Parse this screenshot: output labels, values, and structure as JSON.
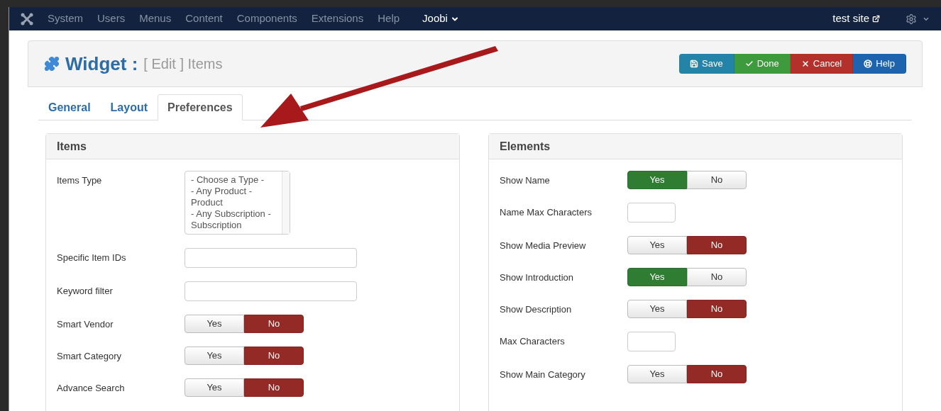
{
  "navbar": {
    "menu": [
      {
        "label": "System"
      },
      {
        "label": "Users"
      },
      {
        "label": "Menus"
      },
      {
        "label": "Content"
      },
      {
        "label": "Components"
      },
      {
        "label": "Extensions"
      },
      {
        "label": "Help"
      }
    ],
    "dropdown": "Joobi",
    "site_link": "test site"
  },
  "header": {
    "title": "Widget :",
    "subtitle": "[ Edit ] Items",
    "buttons": [
      {
        "label": "Save",
        "kind": "save"
      },
      {
        "label": "Done",
        "kind": "done"
      },
      {
        "label": "Cancel",
        "kind": "cancel"
      },
      {
        "label": "Help",
        "kind": "help"
      }
    ]
  },
  "tabs": [
    {
      "label": "General",
      "selected": false
    },
    {
      "label": "Layout",
      "selected": false
    },
    {
      "label": "Preferences",
      "selected": true
    }
  ],
  "panels": [
    {
      "title": "Items",
      "fields": [
        {
          "label": "Items Type",
          "kind": "listbox",
          "options": [
            "- Choose a Type -",
            "- Any Product -",
            "Product",
            "- Any Subscription -",
            "Subscription"
          ]
        },
        {
          "label": "Specific Item IDs",
          "kind": "textbox"
        },
        {
          "label": "Keyword filter",
          "kind": "textbox"
        },
        {
          "label": "Smart Vendor",
          "kind": "toggle",
          "yes": "Yes",
          "no": "No",
          "on": false
        },
        {
          "label": "Smart Category",
          "kind": "toggle",
          "yes": "Yes",
          "no": "No",
          "on": false
        },
        {
          "label": "Advance Search",
          "kind": "toggle",
          "yes": "Yes",
          "no": "No",
          "on": false
        }
      ]
    },
    {
      "title": "Elements",
      "fields": [
        {
          "label": "Show Name",
          "kind": "toggle",
          "yes": "Yes",
          "no": "No",
          "on": true
        },
        {
          "label": "Name Max Characters",
          "kind": "numberbox"
        },
        {
          "label": "Show Media Preview",
          "kind": "toggle",
          "yes": "Yes",
          "no": "No",
          "on": false
        },
        {
          "label": "Show Introduction",
          "kind": "toggle",
          "yes": "Yes",
          "no": "No",
          "on": true
        },
        {
          "label": "Show Description",
          "kind": "toggle",
          "yes": "Yes",
          "no": "No",
          "on": false
        },
        {
          "label": "Max Characters",
          "kind": "numberbox"
        },
        {
          "label": "Show Main Category",
          "kind": "toggle",
          "yes": "Yes",
          "no": "No",
          "on": false
        }
      ]
    }
  ]
}
